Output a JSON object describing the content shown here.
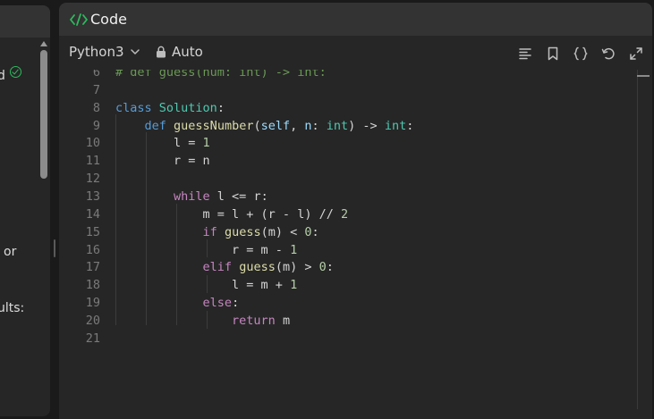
{
  "left_panel": {
    "fragments": [
      {
        "text": "d"
      },
      {
        "text": "or"
      },
      {
        "text": "ults:"
      }
    ],
    "solved_icon": "check-circle-icon"
  },
  "code_panel": {
    "title": "Code",
    "title_icon": "code-brackets-icon",
    "language": "Python3",
    "mode": "Auto",
    "toolbar_icons": [
      "format-icon",
      "bookmark-icon",
      "braces-icon",
      "reset-icon",
      "expand-icon"
    ],
    "lines": [
      {
        "n": "6",
        "tokens": [
          {
            "t": "# def guess(num: int) -> int:",
            "c": "cmt"
          }
        ]
      },
      {
        "n": "7",
        "tokens": []
      },
      {
        "n": "8",
        "tokens": [
          {
            "t": "class",
            "c": "kw-blue"
          },
          {
            "t": " "
          },
          {
            "t": "Solution",
            "c": "cls"
          },
          {
            "t": ":"
          }
        ]
      },
      {
        "n": "9",
        "tokens": [
          {
            "t": "    "
          },
          {
            "t": "def",
            "c": "kw-blue"
          },
          {
            "t": " "
          },
          {
            "t": "guessNumber",
            "c": "fn"
          },
          {
            "t": "("
          },
          {
            "t": "self",
            "c": "param"
          },
          {
            "t": ", "
          },
          {
            "t": "n",
            "c": "param"
          },
          {
            "t": ": "
          },
          {
            "t": "int",
            "c": "cls"
          },
          {
            "t": ") -> "
          },
          {
            "t": "int",
            "c": "cls"
          },
          {
            "t": ":"
          }
        ]
      },
      {
        "n": "10",
        "tokens": [
          {
            "t": "        l = "
          },
          {
            "t": "1",
            "c": "num"
          }
        ]
      },
      {
        "n": "11",
        "tokens": [
          {
            "t": "        r = n"
          }
        ]
      },
      {
        "n": "12",
        "tokens": []
      },
      {
        "n": "13",
        "tokens": [
          {
            "t": "        "
          },
          {
            "t": "while",
            "c": "kw-purple"
          },
          {
            "t": " l <= r:"
          }
        ]
      },
      {
        "n": "14",
        "tokens": [
          {
            "t": "            m = l + (r - l) // "
          },
          {
            "t": "2",
            "c": "num"
          }
        ]
      },
      {
        "n": "15",
        "tokens": [
          {
            "t": "            "
          },
          {
            "t": "if",
            "c": "kw-purple"
          },
          {
            "t": " "
          },
          {
            "t": "guess",
            "c": "fn"
          },
          {
            "t": "(m) < "
          },
          {
            "t": "0",
            "c": "num"
          },
          {
            "t": ":"
          }
        ]
      },
      {
        "n": "16",
        "tokens": [
          {
            "t": "                r = m - "
          },
          {
            "t": "1",
            "c": "num"
          }
        ]
      },
      {
        "n": "17",
        "tokens": [
          {
            "t": "            "
          },
          {
            "t": "elif",
            "c": "kw-purple"
          },
          {
            "t": " "
          },
          {
            "t": "guess",
            "c": "fn"
          },
          {
            "t": "(m) > "
          },
          {
            "t": "0",
            "c": "num"
          },
          {
            "t": ":"
          }
        ]
      },
      {
        "n": "18",
        "tokens": [
          {
            "t": "                l = m + "
          },
          {
            "t": "1",
            "c": "num"
          }
        ]
      },
      {
        "n": "19",
        "tokens": [
          {
            "t": "            "
          },
          {
            "t": "else",
            "c": "kw-purple"
          },
          {
            "t": ":"
          }
        ]
      },
      {
        "n": "20",
        "tokens": [
          {
            "t": "                "
          },
          {
            "t": "return",
            "c": "kw-purple"
          },
          {
            "t": " m"
          }
        ]
      },
      {
        "n": "21",
        "tokens": []
      }
    ]
  },
  "colors": {
    "background": "#1a1a1a",
    "panel": "#262626",
    "header": "#333333",
    "accent_green": "#2cbb5d"
  }
}
